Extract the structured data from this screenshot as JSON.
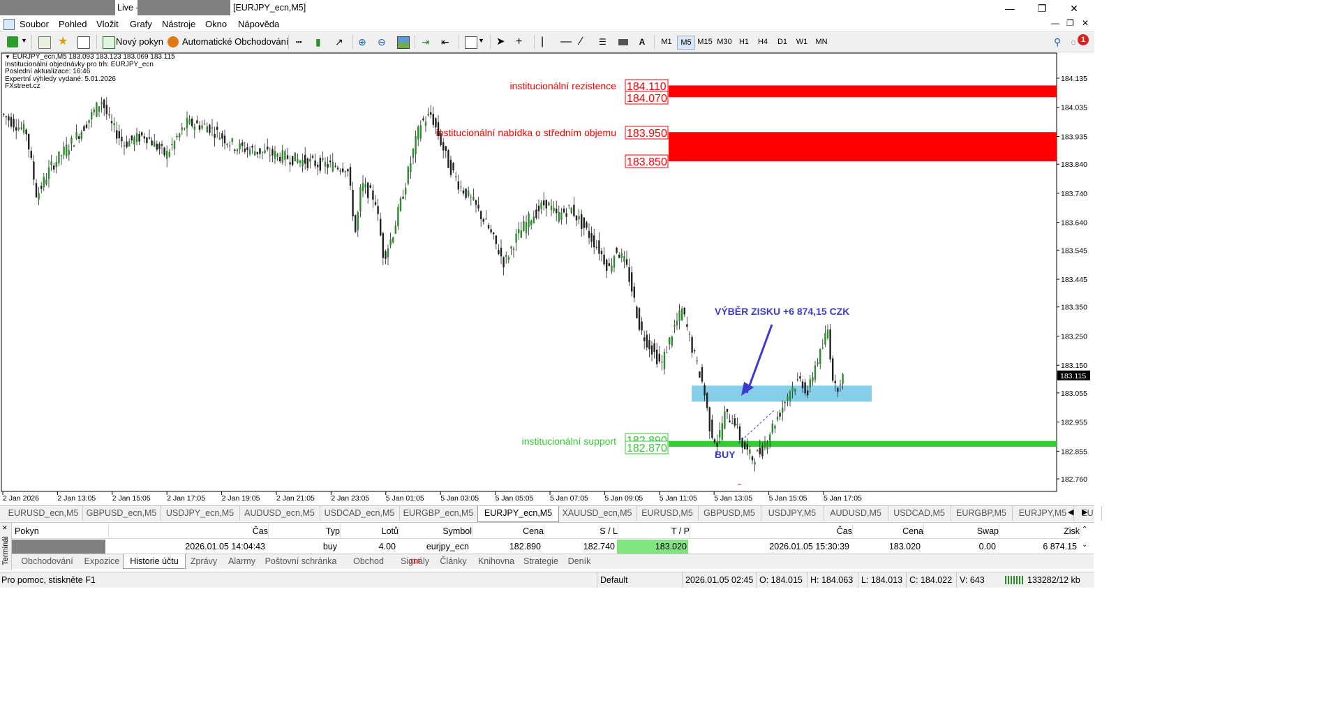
{
  "window": {
    "title_prefix": "Live -",
    "title_chart": "[EURJPY_ecn,M5]"
  },
  "menu": [
    "Soubor",
    "Pohled",
    "Vložit",
    "Grafy",
    "Nástroje",
    "Okno",
    "Nápověda"
  ],
  "toolbar": {
    "new_order": "Nový pokyn",
    "auto_trading": "Automatické Obchodování",
    "timeframes": [
      "M1",
      "M5",
      "M15",
      "M30",
      "H1",
      "H4",
      "D1",
      "W1",
      "MN"
    ],
    "active_timeframe": "M5",
    "text_tool": "A",
    "notification_count": "1"
  },
  "chart": {
    "header_line": "EURJPY_ecn,M5  183.093 183.123 183.069 183.115",
    "info_lines": [
      "Institucionální objednávky pro trh: EURJPY_ecn",
      "Poslední aktualizace: 16:46",
      "Expertní výhledy vydané: 5.01.2026",
      "FXstreet.cz"
    ],
    "price_axis": [
      "184.135",
      "184.035",
      "183.935",
      "183.840",
      "183.740",
      "183.640",
      "183.545",
      "183.445",
      "183.350",
      "183.250",
      "183.150",
      "183.055",
      "182.955",
      "182.855",
      "182.760"
    ],
    "current_price": "183.115",
    "time_axis": [
      "2 Jan 2026",
      "2 Jan 13:05",
      "2 Jan 15:05",
      "2 Jan 17:05",
      "2 Jan 19:05",
      "2 Jan 21:05",
      "2 Jan 23:05",
      "5 Jan 01:05",
      "5 Jan 03:05",
      "5 Jan 05:05",
      "5 Jan 07:05",
      "5 Jan 09:05",
      "5 Jan 11:05",
      "5 Jan 13:05",
      "5 Jan 15:05",
      "5 Jan 17:05"
    ],
    "zones": {
      "resistance_label": "institucionální rezistence",
      "resistance_top": "184.110",
      "resistance_bottom": "184.070",
      "supply_label": "institucionální nabídka o středním objemu",
      "supply_top": "183.950",
      "supply_bottom": "183.850",
      "support_label": "institucionální support",
      "support_top": "182.890",
      "support_bottom": "182.870"
    },
    "annotations": {
      "profit": "VÝBĚR ZISKU +6 874,15 CZK",
      "buy": "BUY"
    },
    "colors": {
      "red_zone": "#ff0000",
      "green_zone": "#33cc33",
      "take_profit_zone": "#87ceeb",
      "annotation_blue": "#3b3bd0",
      "candle_up": "#2e8b2e",
      "candle_down": "#222222"
    }
  },
  "chart_tabs": [
    "EURUSD_ecn,M5",
    "GBPUSD_ecn,M5",
    "USDJPY_ecn,M5",
    "AUDUSD_ecn,M5",
    "USDCAD_ecn,M5",
    "EURGBP_ecn,M5",
    "EURJPY_ecn,M5",
    "XAUUSD_ecn,M5",
    "EURUSD,M5",
    "GBPUSD,M5",
    "USDJPY,M5",
    "AUDUSD,M5",
    "USDCAD,M5",
    "EURGBP,M5",
    "EURJPY,M5",
    "EU"
  ],
  "active_chart_tab": "EURJPY_ecn,M5",
  "terminal": {
    "side_label": "Terminál",
    "columns": [
      "Pokyn",
      "Čas",
      "Typ",
      "Lotů",
      "Symbol",
      "Cena",
      "S / L",
      "T / P",
      "Čas",
      "Cena",
      "Swap",
      "Zisk"
    ],
    "row": {
      "time": "2026.01.05 14:04:43",
      "type": "buy",
      "lots": "4.00",
      "symbol": "eurjpy_ecn",
      "price": "182.890",
      "sl": "182.740",
      "tp": "183.020",
      "close_time": "2026.01.05 15:30:39",
      "close_price": "183.020",
      "swap": "0.00",
      "profit": "6 874.15"
    },
    "tabs": [
      "Obchodování",
      "Expozice",
      "Historie účtu",
      "Zprávy",
      "Alarmy",
      "Poštovní schránka",
      "Obchod",
      "Signály",
      "Články",
      "Knihovna",
      "Strategie",
      "Deník"
    ],
    "active_tab": "Historie účtu",
    "obchod_badge": "114"
  },
  "status": {
    "help": "Pro pomoc, stiskněte F1",
    "profile": "Default",
    "datetime": "2026.01.05 02:45",
    "open": "O: 184.015",
    "high": "H: 184.063",
    "low": "L: 184.013",
    "close": "C: 184.022",
    "volume": "V: 643",
    "traffic": "133282/12 kb"
  }
}
